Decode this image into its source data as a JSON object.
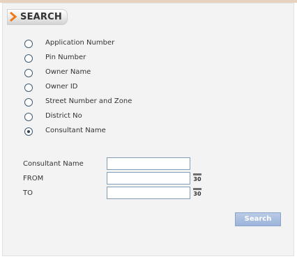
{
  "header": {
    "title": "SEARCH",
    "accent_color": "#f07a14"
  },
  "search_options": [
    {
      "label": "Application Number",
      "selected": false
    },
    {
      "label": "Pin Number",
      "selected": false
    },
    {
      "label": "Owner Name",
      "selected": false
    },
    {
      "label": "Owner ID",
      "selected": false
    },
    {
      "label": "Street Number and Zone",
      "selected": false
    },
    {
      "label": "District No",
      "selected": false
    },
    {
      "label": "Consultant Name",
      "selected": true
    }
  ],
  "form": {
    "consultant_label": "Consultant Name",
    "consultant_value": "",
    "from_label": "FROM",
    "from_value": "",
    "to_label": "TO",
    "to_value": "",
    "calendar_day": "30"
  },
  "search_button": "Search"
}
